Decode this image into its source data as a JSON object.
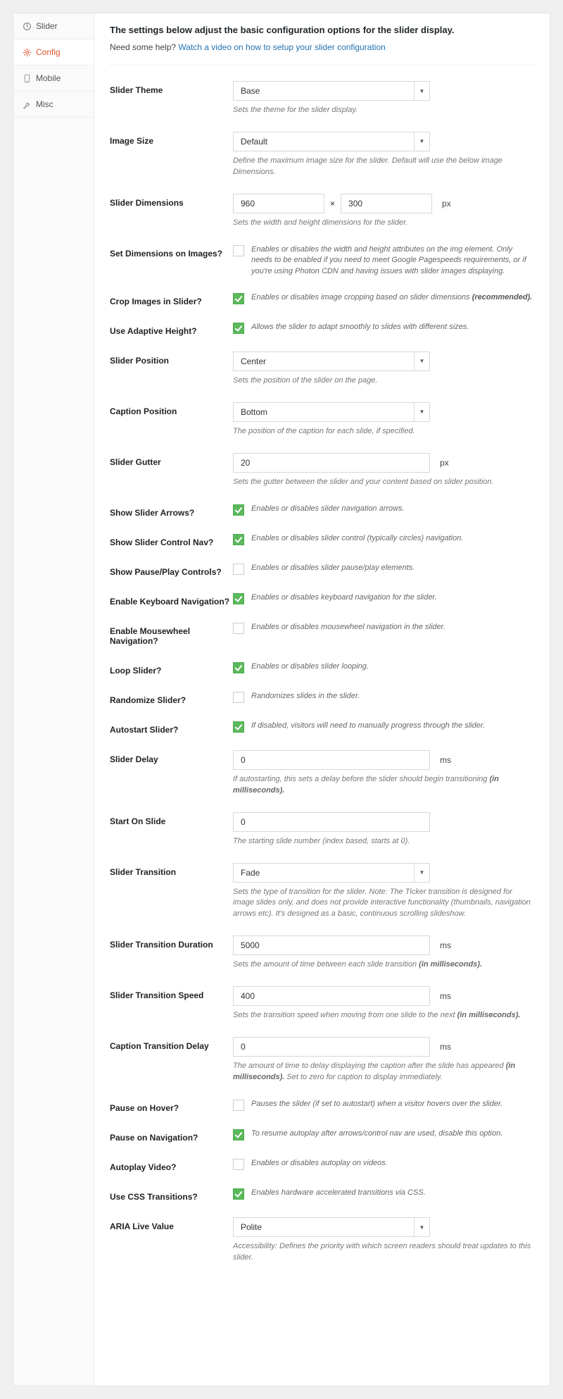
{
  "sidebar": {
    "items": [
      {
        "label": "Slider"
      },
      {
        "label": "Config"
      },
      {
        "label": "Mobile"
      },
      {
        "label": "Misc"
      }
    ]
  },
  "header": {
    "title": "The settings below adjust the basic configuration options for the slider display.",
    "help_prefix": "Need some help?",
    "help_link": "Watch a video on how to setup your slider configuration"
  },
  "fields": {
    "theme": {
      "label": "Slider Theme",
      "value": "Base",
      "hint": "Sets the theme for the slider display."
    },
    "image_size": {
      "label": "Image Size",
      "value": "Default",
      "hint": "Define the maximum image size for the slider. Default will use the below image Dimensions."
    },
    "dimensions": {
      "label": "Slider Dimensions",
      "w": "960",
      "h": "300",
      "sep": "×",
      "unit": "px",
      "hint": "Sets the width and height dimensions for the slider."
    },
    "set_dim": {
      "label": "Set Dimensions on Images?",
      "checked": false,
      "desc": "Enables or disables the width and height attributes on the img element. Only needs to be enabled if you need to meet Google Pagespeeds requirements, or if you're using Photon CDN and having issues with slider images displaying."
    },
    "crop": {
      "label": "Crop Images in Slider?",
      "checked": true,
      "desc": "Enables or disables image cropping based on slider dimensions ",
      "strong": "(recommended)."
    },
    "adaptive": {
      "label": "Use Adaptive Height?",
      "checked": true,
      "desc": "Allows the slider to adapt smoothly to slides with different sizes."
    },
    "position": {
      "label": "Slider Position",
      "value": "Center",
      "hint": "Sets the position of the slider on the page."
    },
    "caption_pos": {
      "label": "Caption Position",
      "value": "Bottom",
      "hint": "The position of the caption for each slide, if specified."
    },
    "gutter": {
      "label": "Slider Gutter",
      "value": "20",
      "unit": "px",
      "hint": "Sets the gutter between the slider and your content based on slider position."
    },
    "arrows": {
      "label": "Show Slider Arrows?",
      "checked": true,
      "desc": "Enables or disables slider navigation arrows."
    },
    "control_nav": {
      "label": "Show Slider Control Nav?",
      "checked": true,
      "desc": "Enables or disables slider control (typically circles) navigation."
    },
    "pause_play": {
      "label": "Show Pause/Play Controls?",
      "checked": false,
      "desc": "Enables or disables slider pause/play elements."
    },
    "keyboard": {
      "label": "Enable Keyboard Navigation?",
      "checked": true,
      "desc": "Enables or disables keyboard navigation for the slider."
    },
    "mousewheel": {
      "label": "Enable Mousewheel Navigation?",
      "checked": false,
      "desc": "Enables or disables mousewheel navigation in the slider."
    },
    "loop": {
      "label": "Loop Slider?",
      "checked": true,
      "desc": "Enables or disables slider looping."
    },
    "randomize": {
      "label": "Randomize Slider?",
      "checked": false,
      "desc": "Randomizes slides in the slider."
    },
    "autostart": {
      "label": "Autostart Slider?",
      "checked": true,
      "desc": "If disabled, visitors will need to manually progress through the slider."
    },
    "delay": {
      "label": "Slider Delay",
      "value": "0",
      "unit": "ms",
      "hint": "If autostarting, this sets a delay before the slider should begin transitioning ",
      "strong": "(in milliseconds)."
    },
    "start_on": {
      "label": "Start On Slide",
      "value": "0",
      "hint": "The starting slide number (index based, starts at 0)."
    },
    "transition": {
      "label": "Slider Transition",
      "value": "Fade",
      "hint": "Sets the type of transition for the slider. Note: The Ticker transition is designed for image slides only, and does not provide interactive functionality (thumbnails, navigation arrows etc). It's designed as a basic, continuous scrolling slideshow."
    },
    "trans_dur": {
      "label": "Slider Transition Duration",
      "value": "5000",
      "unit": "ms",
      "hint": "Sets the amount of time between each slide transition ",
      "strong": "(in milliseconds)."
    },
    "trans_speed": {
      "label": "Slider Transition Speed",
      "value": "400",
      "unit": "ms",
      "hint": "Sets the transition speed when moving from one slide to the next ",
      "strong": "(in milliseconds)."
    },
    "caption_delay": {
      "label": "Caption Transition Delay",
      "value": "0",
      "unit": "ms",
      "hint": "The amount of time to delay displaying the caption after the slide has appeared ",
      "strong": "(in milliseconds).",
      "hint2": " Set to zero for caption to display immediately."
    },
    "pause_hover": {
      "label": "Pause on Hover?",
      "checked": false,
      "desc": "Pauses the slider (if set to autostart) when a visitor hovers over the slider."
    },
    "pause_nav": {
      "label": "Pause on Navigation?",
      "checked": true,
      "desc": "To resume autoplay after arrows/control nav are used, disable this option."
    },
    "autoplay_video": {
      "label": "Autoplay Video?",
      "checked": false,
      "desc": "Enables or disables autoplay on videos."
    },
    "css_trans": {
      "label": "Use CSS Transitions?",
      "checked": true,
      "desc": "Enables hardware accelerated transitions via CSS."
    },
    "aria": {
      "label": "ARIA Live Value",
      "value": "Polite",
      "hint": "Accessibility: Defines the priority with which screen readers should treat updates to this slider."
    }
  }
}
